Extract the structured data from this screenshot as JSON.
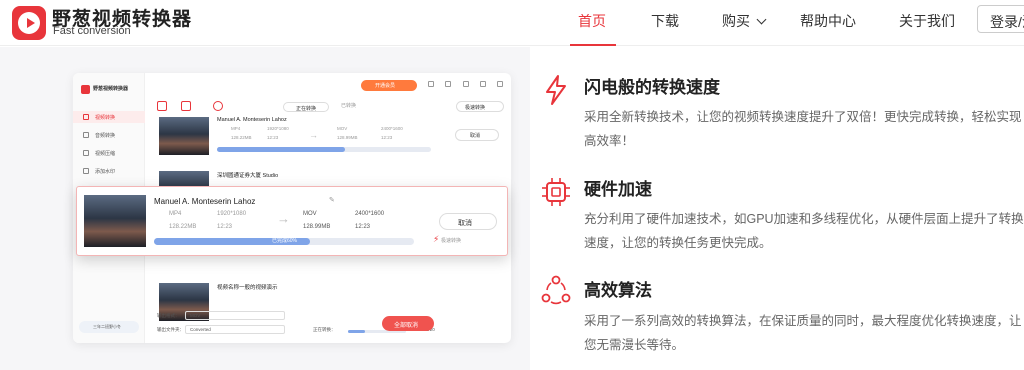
{
  "nav": {
    "brand_cn": "野葱视频转换器",
    "brand_en": "Fast conversion",
    "items": [
      {
        "label": "首页",
        "active": true
      },
      {
        "label": "下载"
      },
      {
        "label": "购买"
      },
      {
        "label": "帮助中心"
      },
      {
        "label": "关于我们"
      }
    ],
    "login": "登录/注"
  },
  "colors": {
    "accent": "#e8353b",
    "progress": "#7fa4e8"
  },
  "app": {
    "title": "野葱视频转换器",
    "open_vip": "开通会员",
    "sidebar": [
      {
        "label": "视频转换",
        "active": true
      },
      {
        "label": "音频转换"
      },
      {
        "label": "视频压缩"
      },
      {
        "label": "添加水印"
      },
      {
        "label": "视频剪辑"
      }
    ],
    "user": "三年二班野小冬",
    "tabs": {
      "converting": "正在转换",
      "converted": "已转换"
    },
    "speed_btn": "极速转换",
    "rows": [
      {
        "name": "Manuel A. Monteserin Lahoz",
        "fmt": "MP4",
        "res": "1920*1080",
        "size": "128.22MB",
        "time": "12:23",
        "out_fmt": "MOV",
        "out_res": "2400*1600",
        "out_size": "128.99MB",
        "out_time": "12:23",
        "progress": "已完成60%",
        "cancel": "取消"
      },
      {
        "name": "深圳圆通证券大厦 Studio"
      },
      {
        "name": "视频名称一般的视频演示"
      }
    ],
    "footer": {
      "out_format_label": "输出格式：",
      "out_format": "MOV",
      "out_folder_label": "输出文件夹：",
      "out_folder": "Converted",
      "converting_label": "正在转换：",
      "pct": "30%",
      "count": "2/20",
      "all_cancel": "全部取消"
    }
  },
  "zoom": {
    "name": "Manuel A. Monteserin Lahoz",
    "fmt": "MP4",
    "res": "1920*1080",
    "size": "128.22MB",
    "time": "12:23",
    "out_fmt": "MOV",
    "out_res": "2400*1600",
    "out_size": "128.99MB",
    "out_time": "12:23",
    "progress_text": "已完成60%",
    "progress": 0.6,
    "cancel": "取消",
    "speed": "极速转换"
  },
  "features": [
    {
      "title": "闪电般的转换速度",
      "desc": "采用全新转换技术，让您的视频转换速度提升了双倍！更快完成转换，轻松实现高效率！",
      "icon": "lightning-icon"
    },
    {
      "title": "硬件加速",
      "desc": "充分利用了硬件加速技术，如GPU加速和多线程优化，从硬件层面上提升了转换速度，让您的转换任务更快完成。",
      "icon": "chip-icon"
    },
    {
      "title": "高效算法",
      "desc": "采用了一系列高效的转换算法，在保证质量的同时，最大程度优化转换速度，让您无需漫长等待。",
      "icon": "algorithm-icon"
    }
  ]
}
